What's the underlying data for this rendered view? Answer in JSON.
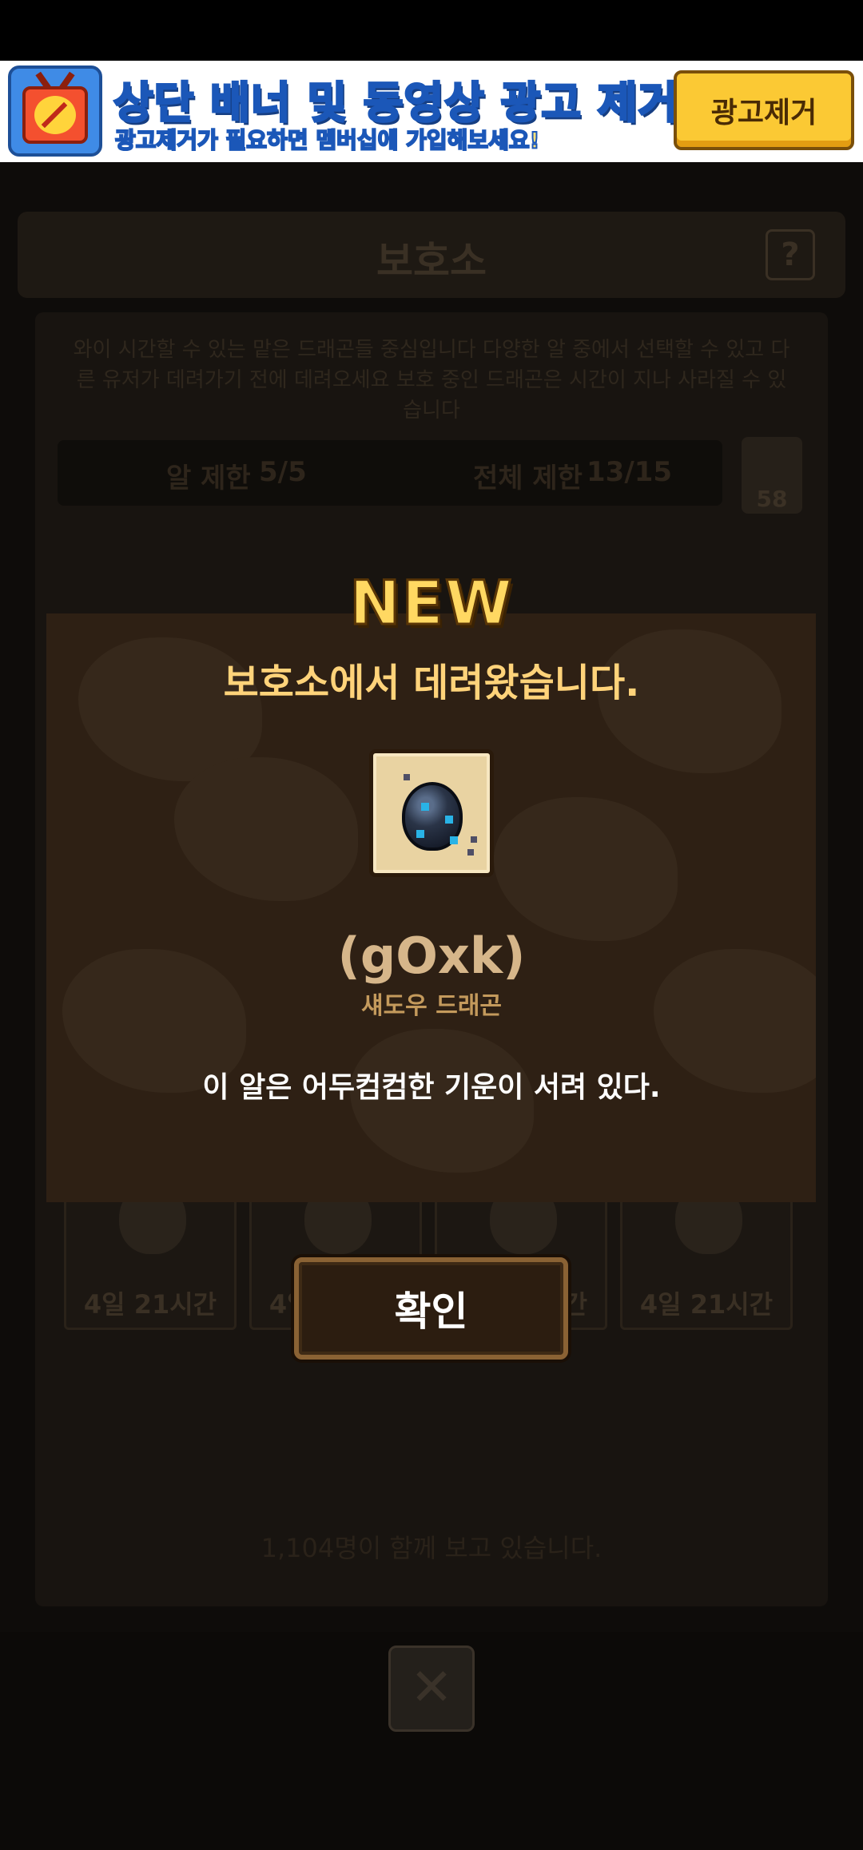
{
  "ad": {
    "title": "상단 배너 및 동영상 광고 제거!",
    "subtitle": "광고제거가 필요하면 멤버십에 가입해보세요!",
    "remove_button": "광고제거"
  },
  "background": {
    "title": "보호소",
    "help": "?",
    "description": "와이 시간할 수 있는 맡은 드래곤들 중심입니다 다양한 알 중에서 선택할 수 있고 다른 유저가 데려가기 전에 데려오세요 보호 중인 드래곤은 시간이 지나 사라질 수 있습니다",
    "egg_limit_label": "알 제한",
    "egg_limit_value": "5/5",
    "total_limit_label": "전체 제한",
    "total_limit_value": "13/15",
    "refresh_count": "58",
    "card_time": "4일 21시간",
    "footer": "1,104명이 함께 보고 있습니다.",
    "close": "✕"
  },
  "modal": {
    "badge": "NEW",
    "title": "보호소에서 데려왔습니다.",
    "dragon_name": "(gOxk)",
    "dragon_type": "섀도우 드래곤",
    "description": "이 알은 어두컴컴한 기운이 서려 있다.",
    "confirm_button": "확인"
  }
}
